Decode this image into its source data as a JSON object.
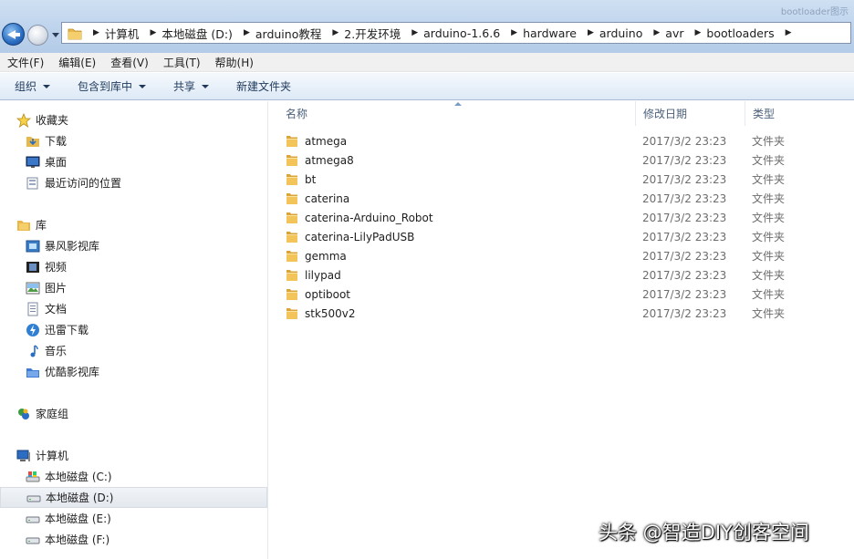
{
  "window": {
    "title": "bootloader图示"
  },
  "address_bar": {
    "crumbs": [
      "计算机",
      "本地磁盘 (D:)",
      "arduino教程",
      "2.开发环境",
      "arduino-1.6.6",
      "hardware",
      "arduino",
      "avr",
      "bootloaders"
    ]
  },
  "menu": [
    "文件(F)",
    "编辑(E)",
    "查看(V)",
    "工具(T)",
    "帮助(H)"
  ],
  "commands": [
    {
      "label": "组织",
      "dropdown": true
    },
    {
      "label": "包含到库中",
      "dropdown": true
    },
    {
      "label": "共享",
      "dropdown": true
    },
    {
      "label": "新建文件夹",
      "dropdown": false
    }
  ],
  "nav": {
    "favorites": {
      "label": "收藏夹",
      "icon": "star-icon",
      "items": [
        {
          "label": "下载",
          "icon": "download-folder-icon"
        },
        {
          "label": "桌面",
          "icon": "desktop-icon"
        },
        {
          "label": "最近访问的位置",
          "icon": "recent-places-icon"
        }
      ]
    },
    "libraries": {
      "label": "库",
      "icon": "library-icon",
      "items": [
        {
          "label": "暴风影视库",
          "icon": "storm-video-icon"
        },
        {
          "label": "视频",
          "icon": "video-icon"
        },
        {
          "label": "图片",
          "icon": "pictures-icon"
        },
        {
          "label": "文档",
          "icon": "documents-icon"
        },
        {
          "label": "迅雷下载",
          "icon": "thunder-download-icon"
        },
        {
          "label": "音乐",
          "icon": "music-icon"
        },
        {
          "label": "优酷影视库",
          "icon": "youku-icon"
        }
      ]
    },
    "homegroup": {
      "label": "家庭组",
      "icon": "homegroup-icon"
    },
    "computer": {
      "label": "计算机",
      "icon": "computer-icon",
      "items": [
        {
          "label": "本地磁盘 (C:)",
          "icon": "system-drive-icon"
        },
        {
          "label": "本地磁盘 (D:)",
          "icon": "drive-icon",
          "selected": true
        },
        {
          "label": "本地磁盘 (E:)",
          "icon": "drive-icon"
        },
        {
          "label": "本地磁盘 (F:)",
          "icon": "drive-icon"
        }
      ]
    }
  },
  "columns": {
    "name": "名称",
    "date": "修改日期",
    "type": "类型"
  },
  "files": [
    {
      "name": "atmega",
      "date": "2017/3/2 23:23",
      "type": "文件夹"
    },
    {
      "name": "atmega8",
      "date": "2017/3/2 23:23",
      "type": "文件夹"
    },
    {
      "name": "bt",
      "date": "2017/3/2 23:23",
      "type": "文件夹"
    },
    {
      "name": "caterina",
      "date": "2017/3/2 23:23",
      "type": "文件夹"
    },
    {
      "name": "caterina-Arduino_Robot",
      "date": "2017/3/2 23:23",
      "type": "文件夹"
    },
    {
      "name": "caterina-LilyPadUSB",
      "date": "2017/3/2 23:23",
      "type": "文件夹"
    },
    {
      "name": "gemma",
      "date": "2017/3/2 23:23",
      "type": "文件夹"
    },
    {
      "name": "lilypad",
      "date": "2017/3/2 23:23",
      "type": "文件夹"
    },
    {
      "name": "optiboot",
      "date": "2017/3/2 23:23",
      "type": "文件夹"
    },
    {
      "name": "stk500v2",
      "date": "2017/3/2 23:23",
      "type": "文件夹"
    }
  ],
  "watermark": "头条 @智造DIY创客空间",
  "colors": {
    "accent": "#2a6dc2",
    "folder": "#e8b84a",
    "selection": "#e3e8ee"
  }
}
